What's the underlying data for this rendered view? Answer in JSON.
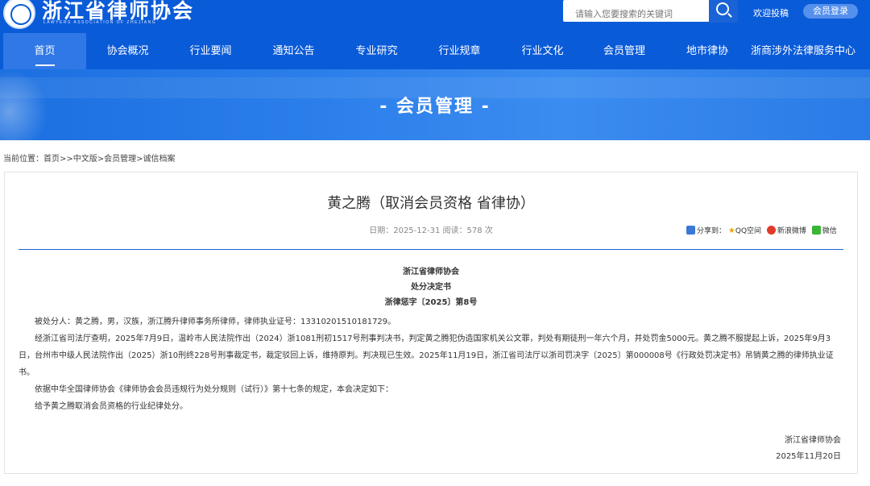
{
  "header": {
    "site_title": "浙江省律师协会",
    "site_subtitle": "LAWYERS ASSOCIATION OF ZHEJIANG",
    "search_placeholder": "请输入您要搜索的关键词",
    "contribute_label": "欢迎投稿",
    "login_label": "会员登录"
  },
  "nav": {
    "items": [
      {
        "label": "首页",
        "active": true
      },
      {
        "label": "协会概况"
      },
      {
        "label": "行业要闻"
      },
      {
        "label": "通知公告"
      },
      {
        "label": "专业研究"
      },
      {
        "label": "行业规章"
      },
      {
        "label": "行业文化"
      },
      {
        "label": "会员管理"
      },
      {
        "label": "地市律协"
      },
      {
        "label": "浙商涉外法律服务中心"
      }
    ]
  },
  "banner": {
    "title": "- 会员管理 -"
  },
  "breadcrumb": "当前位置：首页>>中文版>会员管理>诚信档案",
  "article": {
    "title": "黄之腾（取消会员资格 省律协）",
    "meta": "日期：2025-12-31 阅读：578 次",
    "share": {
      "label": "分享到：",
      "qq": "QQ空间",
      "weibo": "新浪微博",
      "wechat": "微信"
    },
    "doc_org": "浙江省律师协会",
    "doc_type": "处分决定书",
    "doc_number": "浙律惩字〔2025〕第8号",
    "paragraphs": [
      "被处分人：黄之腾，男，汉族，浙江腾升律师事务所律师，律师执业证号：13310201510181729。",
      "经浙江省司法厅查明，2025年7月9日，温岭市人民法院作出（2024）浙1081刑初1517号刑事判决书，判定黄之腾犯伪造国家机关公文罪，判处有期徒刑一年六个月，并处罚金5000元。黄之腾不服提起上诉，2025年9月3日，台州市中级人民法院作出（2025）浙10刑终228号刑事裁定书，裁定驳回上诉，维持原判。判决现已生效。2025年11月19日，浙江省司法厅以浙司罚决字〔2025〕第000008号《行政处罚决定书》吊销黄之腾的律师执业证书。",
      "依据中华全国律师协会《律师协会会员违规行为处分规则（试行）》第十七条的规定，本会决定如下：",
      "给予黄之腾取消会员资格的行业纪律处分。"
    ],
    "signature_org": "浙江省律师协会",
    "signature_date": "2025年11月20日"
  }
}
